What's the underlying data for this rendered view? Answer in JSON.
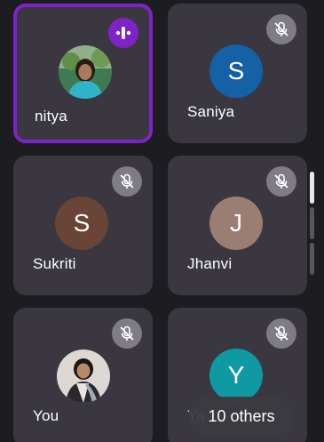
{
  "participants": [
    {
      "name": "nitya",
      "initial": "",
      "avatar_color": "#2f6b5a",
      "speaking": true
    },
    {
      "name": "Saniya",
      "initial": "S",
      "avatar_color": "#1561a6",
      "speaking": false
    },
    {
      "name": "Sukriti",
      "initial": "S",
      "avatar_color": "#6a4437",
      "speaking": false
    },
    {
      "name": "Jhanvi",
      "initial": "J",
      "avatar_color": "#9a7e72",
      "speaking": false
    },
    {
      "name": "You",
      "initial": "",
      "avatar_color": "#d8d3cf",
      "speaking": false
    },
    {
      "name": "Ya",
      "initial": "Y",
      "avatar_color": "#0f9aa3",
      "speaking": false
    }
  ],
  "overflow": {
    "label": "10 others"
  },
  "icons": {
    "muted": "mic-off-icon",
    "speaking": "speaking-indicator-icon",
    "photo": "profile-photo"
  },
  "colors": {
    "speaking_accent": "#7f23c9",
    "tile_background": "#3a3740",
    "mute_badge": "#807c86"
  }
}
